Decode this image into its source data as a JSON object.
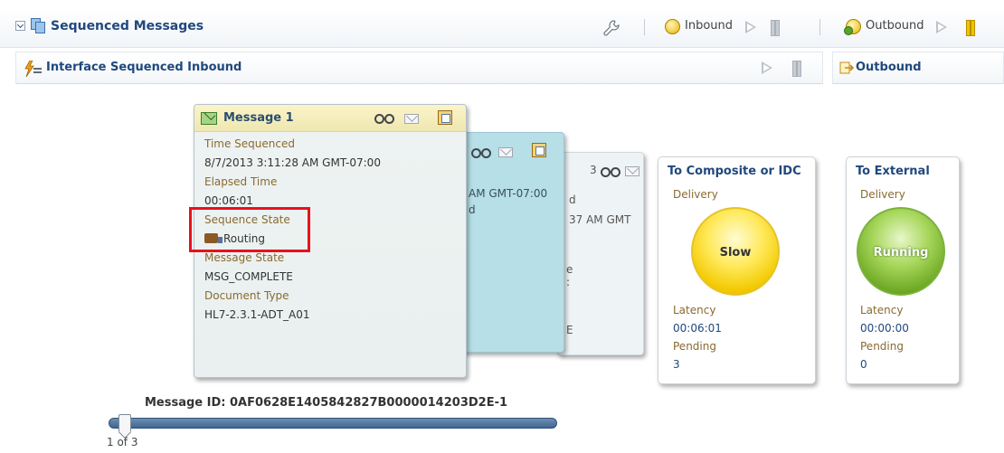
{
  "header": {
    "title": "Sequenced Messages",
    "inbound_label": "Inbound",
    "outbound_label": "Outbound"
  },
  "inbound_panel": {
    "title": "Interface Sequenced Inbound"
  },
  "outbound_panel": {
    "title": "Outbound"
  },
  "message_card": {
    "title": "Message 1",
    "fields": [
      {
        "label": "Time Sequenced",
        "value": "8/7/2013 3:11:28 AM GMT-07:00"
      },
      {
        "label": "Elapsed Time",
        "value": "00:06:01"
      },
      {
        "label": "Sequence State",
        "value": "Routing"
      },
      {
        "label": "Message State",
        "value": "MSG_COMPLETE"
      },
      {
        "label": "Document Type",
        "value": "HL7-2.3.1-ADT_A01"
      }
    ]
  },
  "back_cards": {
    "card2_fragments": [
      "AM GMT-07:00",
      "d"
    ],
    "card3_fragments": [
      "3",
      "d",
      "37 AM GMT",
      "e",
      ":",
      "E"
    ]
  },
  "status_cards": [
    {
      "title": "To Composite or IDC",
      "delivery_label": "Delivery",
      "state": "Slow",
      "state_color": "#f2c900",
      "latency_label": "Latency",
      "latency": "00:06:01",
      "pending_label": "Pending",
      "pending": "3"
    },
    {
      "title": "To External",
      "delivery_label": "Delivery",
      "state": "Running",
      "state_color": "#6faa25",
      "latency_label": "Latency",
      "latency": "00:00:00",
      "pending_label": "Pending",
      "pending": "0"
    }
  ],
  "message_id": "Message ID: 0AF0628E1405842827B0000014203D2E-1",
  "pagination": {
    "text": "1 of 3"
  },
  "icons": [
    "chevron-down-icon",
    "documents-icon",
    "wrench-icon",
    "inbound-bulb-icon",
    "play-icon",
    "pause-icon",
    "outbound-bulb-icon",
    "lightning-list-icon",
    "export-icon",
    "message-icon",
    "glasses-icon",
    "envelope-icon",
    "stack-icon",
    "truck-icon"
  ],
  "colors": {
    "title_blue": "#20487d",
    "label_brown": "#8b6a2f",
    "highlight_red": "#e8111c"
  }
}
